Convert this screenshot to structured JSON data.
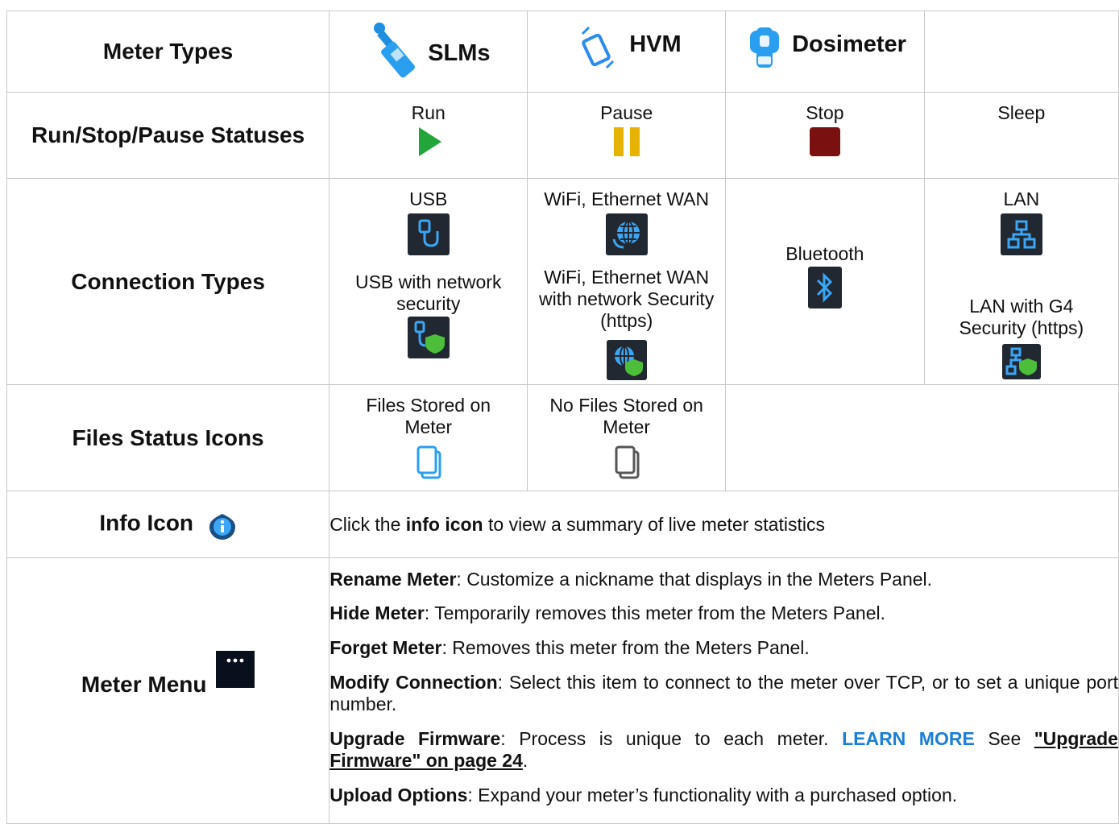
{
  "meter_types": {
    "title": "Meter Types",
    "slms": "SLMs",
    "hvm": "HVM",
    "dosimeter": "Dosimeter"
  },
  "statuses": {
    "title": "Run/Stop/Pause Statuses",
    "run": "Run",
    "pause": "Pause",
    "stop": "Stop",
    "sleep": "Sleep"
  },
  "connections": {
    "title": "Connection Types",
    "usb": "USB",
    "usb_secure": "USB with network security",
    "wifi": "WiFi, Ethernet WAN",
    "wifi_secure": "WiFi, Ethernet WAN with network Security (https)",
    "bluetooth": "Bluetooth",
    "lan": "LAN",
    "lan_secure": "LAN with G4 Security (https)"
  },
  "files": {
    "title": "Files Status Icons",
    "stored": "Files Stored on Meter",
    "none": "No Files Stored on Meter"
  },
  "info": {
    "title": "Info Icon",
    "text_pre": "Click the ",
    "text_bold": "info icon",
    "text_post": " to view a summary of live meter statistics"
  },
  "menu": {
    "title": "Meter Menu",
    "items": [
      {
        "term": "Rename Meter",
        "desc": ": Customize a nickname that displays in the Meters Panel."
      },
      {
        "term": "Hide Meter",
        "desc": ": Temporarily removes this meter from the Meters Panel."
      },
      {
        "term": "Forget Meter",
        "desc": ": Removes this meter from the Meters Panel."
      },
      {
        "term": "Modify Connection",
        "desc": ": Select this item to connect to the meter over TCP, or to set a unique port number."
      },
      {
        "term": "Upgrade Firmware",
        "desc": ": Process is unique to each meter. ",
        "learn": "LEARN MORE",
        "see": " See ",
        "xref": "\"Upgrade Firmware\" on page 24",
        "end": "."
      },
      {
        "term": "Upload Options",
        "desc": ": Expand your meter’s functionality with a purchased option."
      }
    ]
  },
  "colors": {
    "run": "#22a53b",
    "pause": "#e6b400",
    "stop": "#7a1010",
    "sleep": "#2a8cf0",
    "icon_bg": "#222831",
    "accent_blue": "#1a7fd6"
  }
}
